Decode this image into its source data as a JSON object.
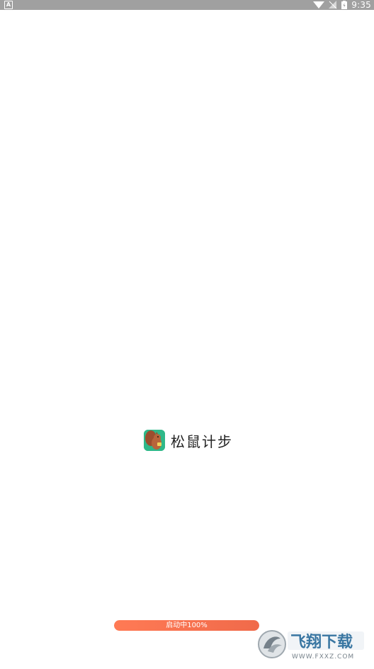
{
  "status_bar": {
    "left_icon_letter": "A",
    "time": "9:35",
    "icons": [
      "wifi-icon",
      "signal-icon",
      "battery-icon"
    ]
  },
  "splash": {
    "app_icon": "squirrel-app-icon",
    "app_name": "松鼠计步"
  },
  "progress": {
    "label": "启动中100%",
    "value": 1.0
  },
  "watermark": {
    "title": "飞翔下载",
    "url": "WWW.FXXZ.COM"
  },
  "colors": {
    "status_bar": "#a0a0a0",
    "progress_fill": "#f06a4a",
    "icon_bg": "#2fb889"
  }
}
